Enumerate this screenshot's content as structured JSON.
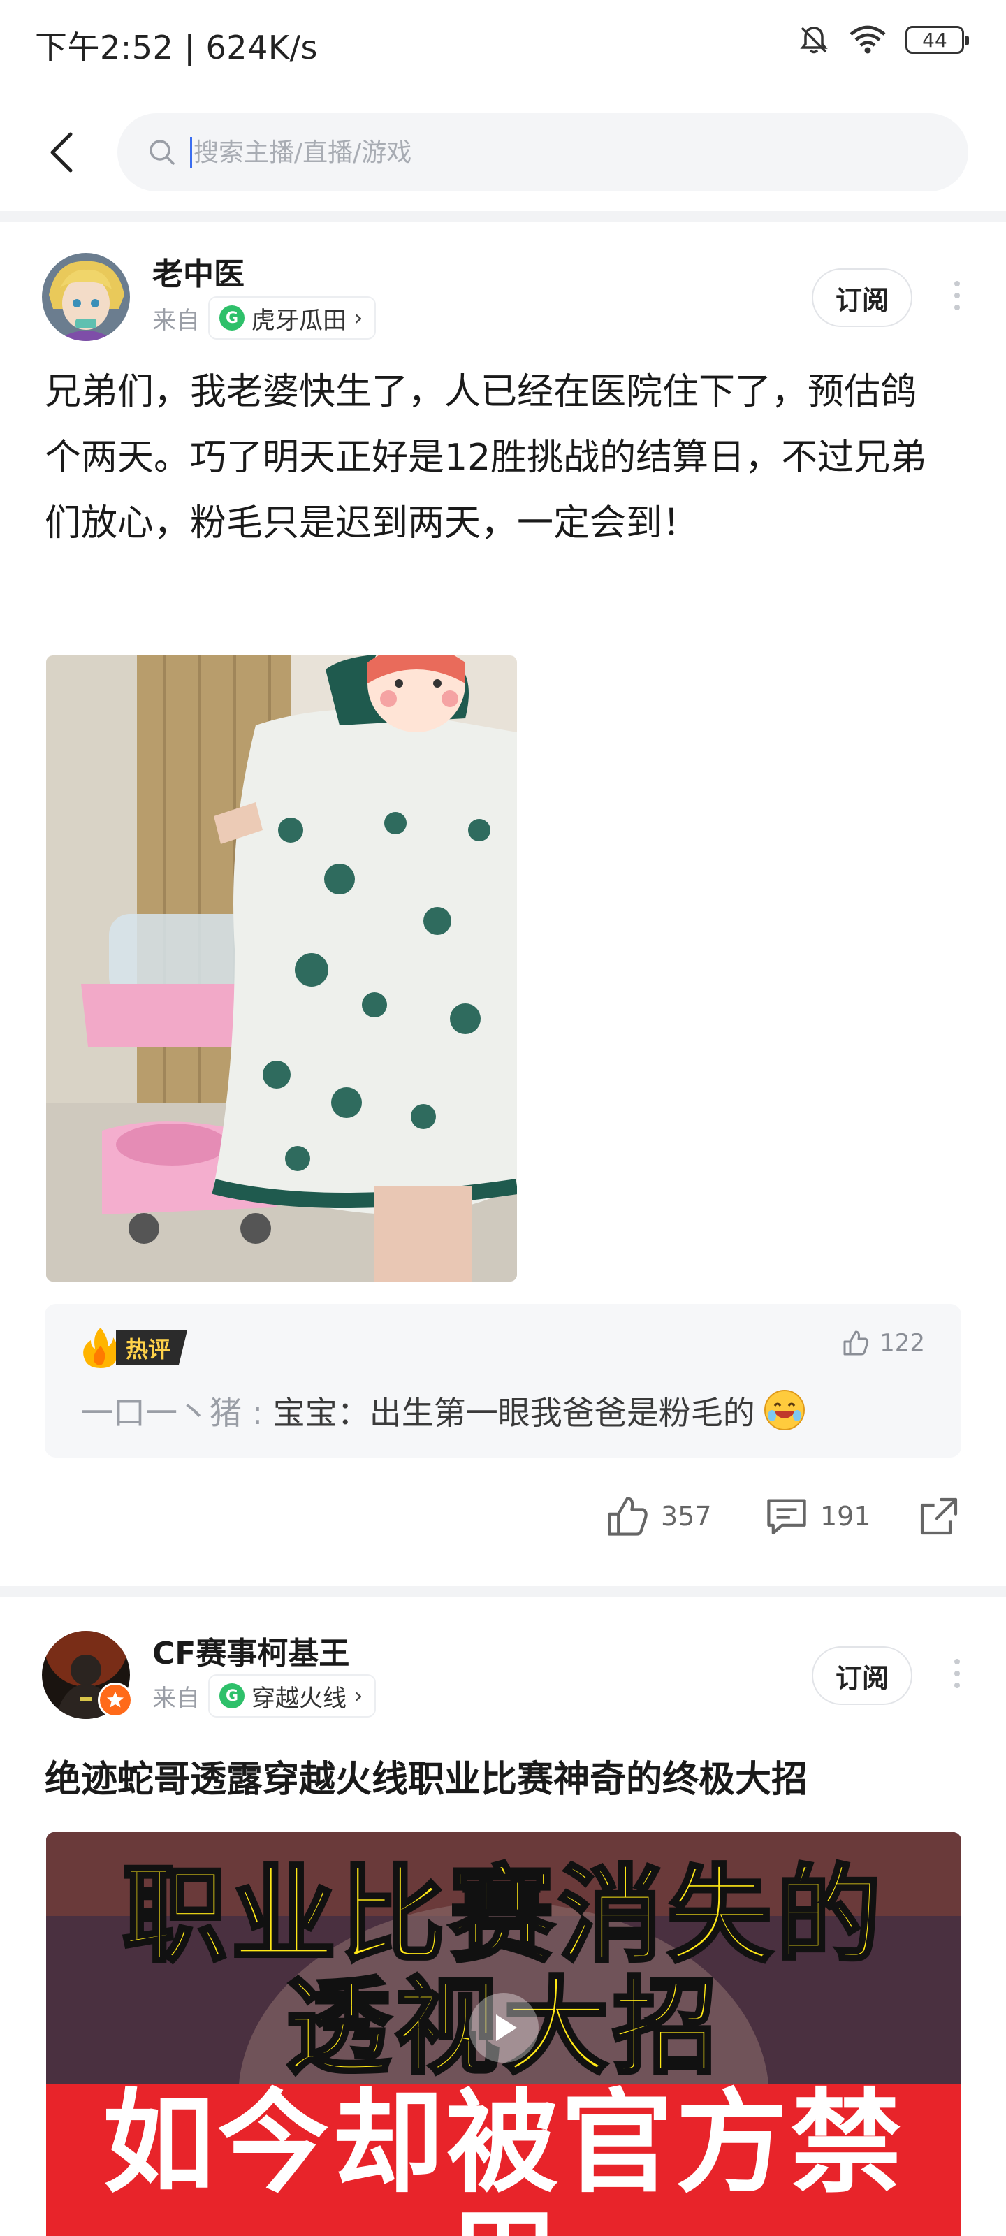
{
  "status_bar": {
    "time_speed": "下午2:52 | 624K/s",
    "battery": "44",
    "icons": [
      "bell-muted-icon",
      "wifi-icon",
      "battery-icon"
    ]
  },
  "search": {
    "placeholder": "搜索主播/直播/游戏"
  },
  "posts": [
    {
      "author": "老中医",
      "from_label": "来自",
      "source": "虎牙瓜田",
      "subscribe_label": "订阅",
      "text": "兄弟们，我老婆快生了，人已经在医院住下了，预估鸽个两天。巧了明天正好是12胜挑战的结算日，不过兄弟们放心，粉毛只是迟到两天，一定会到！",
      "hot_comment": {
        "badge": "热评",
        "likes": "122",
        "user": "一口一丶猪 : ",
        "content": "宝宝：出生第一眼我爸爸是粉毛的"
      },
      "actions": {
        "likes": "357",
        "comments": "191"
      }
    },
    {
      "author": "CF赛事柯基王",
      "from_label": "来自",
      "source": "穿越火线",
      "subscribe_label": "订阅",
      "title": "绝迹蛇哥透露穿越火线职业比赛神奇的终极大招",
      "video_caption_lines": [
        "职业比赛消失的",
        "透视大招",
        "如今却被官方禁用"
      ]
    }
  ],
  "colors": {
    "accent": "#3a6df0",
    "chip_green": "#2ec06a",
    "caption_yellow": "#ffe816",
    "caption_red": "#e8242a"
  }
}
